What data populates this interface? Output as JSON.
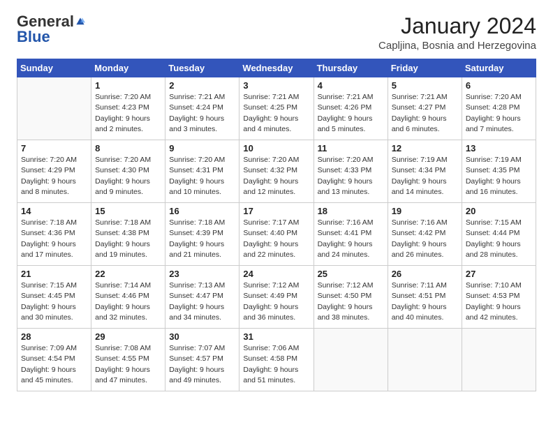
{
  "logo": {
    "general": "General",
    "blue": "Blue",
    "tagline": "GeneralBlue"
  },
  "header": {
    "month": "January 2024",
    "location": "Capljina, Bosnia and Herzegovina"
  },
  "weekdays": [
    "Sunday",
    "Monday",
    "Tuesday",
    "Wednesday",
    "Thursday",
    "Friday",
    "Saturday"
  ],
  "weeks": [
    [
      {
        "day": "",
        "sunrise": "",
        "sunset": "",
        "daylight": "",
        "empty": true
      },
      {
        "day": "1",
        "sunrise": "Sunrise: 7:20 AM",
        "sunset": "Sunset: 4:23 PM",
        "daylight": "Daylight: 9 hours and 2 minutes."
      },
      {
        "day": "2",
        "sunrise": "Sunrise: 7:21 AM",
        "sunset": "Sunset: 4:24 PM",
        "daylight": "Daylight: 9 hours and 3 minutes."
      },
      {
        "day": "3",
        "sunrise": "Sunrise: 7:21 AM",
        "sunset": "Sunset: 4:25 PM",
        "daylight": "Daylight: 9 hours and 4 minutes."
      },
      {
        "day": "4",
        "sunrise": "Sunrise: 7:21 AM",
        "sunset": "Sunset: 4:26 PM",
        "daylight": "Daylight: 9 hours and 5 minutes."
      },
      {
        "day": "5",
        "sunrise": "Sunrise: 7:21 AM",
        "sunset": "Sunset: 4:27 PM",
        "daylight": "Daylight: 9 hours and 6 minutes."
      },
      {
        "day": "6",
        "sunrise": "Sunrise: 7:20 AM",
        "sunset": "Sunset: 4:28 PM",
        "daylight": "Daylight: 9 hours and 7 minutes."
      }
    ],
    [
      {
        "day": "7",
        "sunrise": "Sunrise: 7:20 AM",
        "sunset": "Sunset: 4:29 PM",
        "daylight": "Daylight: 9 hours and 8 minutes."
      },
      {
        "day": "8",
        "sunrise": "Sunrise: 7:20 AM",
        "sunset": "Sunset: 4:30 PM",
        "daylight": "Daylight: 9 hours and 9 minutes."
      },
      {
        "day": "9",
        "sunrise": "Sunrise: 7:20 AM",
        "sunset": "Sunset: 4:31 PM",
        "daylight": "Daylight: 9 hours and 10 minutes."
      },
      {
        "day": "10",
        "sunrise": "Sunrise: 7:20 AM",
        "sunset": "Sunset: 4:32 PM",
        "daylight": "Daylight: 9 hours and 12 minutes."
      },
      {
        "day": "11",
        "sunrise": "Sunrise: 7:20 AM",
        "sunset": "Sunset: 4:33 PM",
        "daylight": "Daylight: 9 hours and 13 minutes."
      },
      {
        "day": "12",
        "sunrise": "Sunrise: 7:19 AM",
        "sunset": "Sunset: 4:34 PM",
        "daylight": "Daylight: 9 hours and 14 minutes."
      },
      {
        "day": "13",
        "sunrise": "Sunrise: 7:19 AM",
        "sunset": "Sunset: 4:35 PM",
        "daylight": "Daylight: 9 hours and 16 minutes."
      }
    ],
    [
      {
        "day": "14",
        "sunrise": "Sunrise: 7:18 AM",
        "sunset": "Sunset: 4:36 PM",
        "daylight": "Daylight: 9 hours and 17 minutes."
      },
      {
        "day": "15",
        "sunrise": "Sunrise: 7:18 AM",
        "sunset": "Sunset: 4:38 PM",
        "daylight": "Daylight: 9 hours and 19 minutes."
      },
      {
        "day": "16",
        "sunrise": "Sunrise: 7:18 AM",
        "sunset": "Sunset: 4:39 PM",
        "daylight": "Daylight: 9 hours and 21 minutes."
      },
      {
        "day": "17",
        "sunrise": "Sunrise: 7:17 AM",
        "sunset": "Sunset: 4:40 PM",
        "daylight": "Daylight: 9 hours and 22 minutes."
      },
      {
        "day": "18",
        "sunrise": "Sunrise: 7:16 AM",
        "sunset": "Sunset: 4:41 PM",
        "daylight": "Daylight: 9 hours and 24 minutes."
      },
      {
        "day": "19",
        "sunrise": "Sunrise: 7:16 AM",
        "sunset": "Sunset: 4:42 PM",
        "daylight": "Daylight: 9 hours and 26 minutes."
      },
      {
        "day": "20",
        "sunrise": "Sunrise: 7:15 AM",
        "sunset": "Sunset: 4:44 PM",
        "daylight": "Daylight: 9 hours and 28 minutes."
      }
    ],
    [
      {
        "day": "21",
        "sunrise": "Sunrise: 7:15 AM",
        "sunset": "Sunset: 4:45 PM",
        "daylight": "Daylight: 9 hours and 30 minutes."
      },
      {
        "day": "22",
        "sunrise": "Sunrise: 7:14 AM",
        "sunset": "Sunset: 4:46 PM",
        "daylight": "Daylight: 9 hours and 32 minutes."
      },
      {
        "day": "23",
        "sunrise": "Sunrise: 7:13 AM",
        "sunset": "Sunset: 4:47 PM",
        "daylight": "Daylight: 9 hours and 34 minutes."
      },
      {
        "day": "24",
        "sunrise": "Sunrise: 7:12 AM",
        "sunset": "Sunset: 4:49 PM",
        "daylight": "Daylight: 9 hours and 36 minutes."
      },
      {
        "day": "25",
        "sunrise": "Sunrise: 7:12 AM",
        "sunset": "Sunset: 4:50 PM",
        "daylight": "Daylight: 9 hours and 38 minutes."
      },
      {
        "day": "26",
        "sunrise": "Sunrise: 7:11 AM",
        "sunset": "Sunset: 4:51 PM",
        "daylight": "Daylight: 9 hours and 40 minutes."
      },
      {
        "day": "27",
        "sunrise": "Sunrise: 7:10 AM",
        "sunset": "Sunset: 4:53 PM",
        "daylight": "Daylight: 9 hours and 42 minutes."
      }
    ],
    [
      {
        "day": "28",
        "sunrise": "Sunrise: 7:09 AM",
        "sunset": "Sunset: 4:54 PM",
        "daylight": "Daylight: 9 hours and 45 minutes."
      },
      {
        "day": "29",
        "sunrise": "Sunrise: 7:08 AM",
        "sunset": "Sunset: 4:55 PM",
        "daylight": "Daylight: 9 hours and 47 minutes."
      },
      {
        "day": "30",
        "sunrise": "Sunrise: 7:07 AM",
        "sunset": "Sunset: 4:57 PM",
        "daylight": "Daylight: 9 hours and 49 minutes."
      },
      {
        "day": "31",
        "sunrise": "Sunrise: 7:06 AM",
        "sunset": "Sunset: 4:58 PM",
        "daylight": "Daylight: 9 hours and 51 minutes."
      },
      {
        "day": "",
        "sunrise": "",
        "sunset": "",
        "daylight": "",
        "empty": true
      },
      {
        "day": "",
        "sunrise": "",
        "sunset": "",
        "daylight": "",
        "empty": true
      },
      {
        "day": "",
        "sunrise": "",
        "sunset": "",
        "daylight": "",
        "empty": true
      }
    ]
  ]
}
